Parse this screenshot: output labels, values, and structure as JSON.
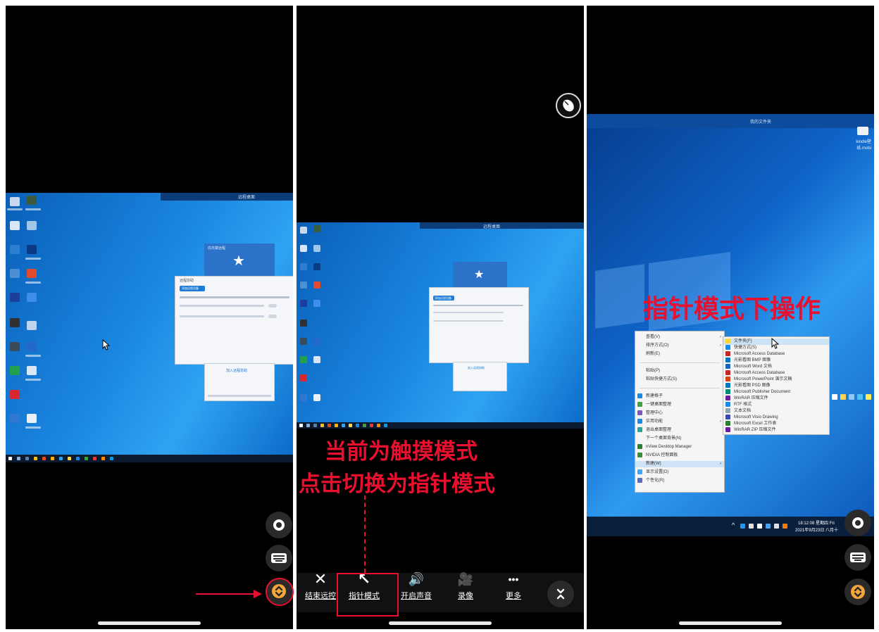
{
  "panel1": {
    "desktop_top_title": "远程桌面",
    "win_title": "向日葵远程",
    "win_tab": "远程协助",
    "win_btn": "添加远程设备",
    "win_bottom_btn": "加入远程协助",
    "buttons": {
      "mode": "pointer-mode-ring",
      "keyboard": "keyboard",
      "expand": "expand"
    }
  },
  "panel2": {
    "annotation_line1": "当前为触摸模式",
    "annotation_line2": "点击切换为指针模式",
    "desktop_top_title": "远程桌面",
    "win_btn": "添加远程设备",
    "win_bottom_btn": "加入远程协助",
    "toolbar": [
      {
        "name": "end-remote",
        "icon": "✕",
        "label": "结束远控"
      },
      {
        "name": "pointer-mode",
        "icon": "↖",
        "label": "指针模式"
      },
      {
        "name": "open-sound",
        "icon": "🔊",
        "label": "开启声音"
      },
      {
        "name": "record",
        "icon": "🎥",
        "label": "录像"
      },
      {
        "name": "more",
        "icon": "•••",
        "label": "更多"
      }
    ],
    "collapse_icon": "collapse"
  },
  "panel3": {
    "desktop_top_title": "我的文件夹",
    "desktop_corner_label": "kindle壁纸.mobi",
    "annotation": "指针模式下操作",
    "context_menu": [
      {
        "label": "查看(V)",
        "arrow": true
      },
      {
        "label": "排序方式(O)",
        "arrow": true
      },
      {
        "label": "刷新(E)",
        "arrow": false
      },
      {
        "label": "",
        "arrow": false
      },
      {
        "label": "粘贴(P)",
        "arrow": false
      },
      {
        "label": "粘贴快捷方式(S)",
        "arrow": false
      },
      {
        "label": "",
        "arrow": false
      },
      {
        "label": "新建格子",
        "arrow": false
      },
      {
        "label": "一键桌面整理",
        "arrow": false
      },
      {
        "label": "整理中心",
        "arrow": false
      },
      {
        "label": "实用功能",
        "arrow": true
      },
      {
        "label": "退出桌面整理",
        "arrow": false
      },
      {
        "label": "下一个桌面背景(N)",
        "arrow": false
      },
      {
        "label": "nView Desktop Manager",
        "arrow": false
      },
      {
        "label": "NVIDIA 控制面板",
        "arrow": false
      },
      {
        "label": "新建(W)",
        "arrow": true
      },
      {
        "label": "显示设置(D)",
        "arrow": false
      },
      {
        "label": "个性化(R)",
        "arrow": false
      }
    ],
    "submenu": [
      "文件夹(F)",
      "快捷方式(S)",
      "Microsoft Access Database",
      "光影看图 BMP 图像",
      "Microsoft Word 文档",
      "Microsoft Access Database",
      "Microsoft PowerPoint 演示文稿",
      "光影看图 PSD 图像",
      "Microsoft Publisher Document",
      "WinRAR 压缩文件",
      "RTF 格式",
      "文本文档",
      "Microsoft Visio Drawing",
      "Microsoft Excel 工作表",
      "WinRAR ZIP 压缩文件"
    ],
    "clock_time": "18:12:08 星期四 Fri",
    "clock_date": "2021年9月23日 八月十"
  },
  "colors": {
    "accent_red": "#e8102e",
    "win_blue": "#1a86e0"
  }
}
